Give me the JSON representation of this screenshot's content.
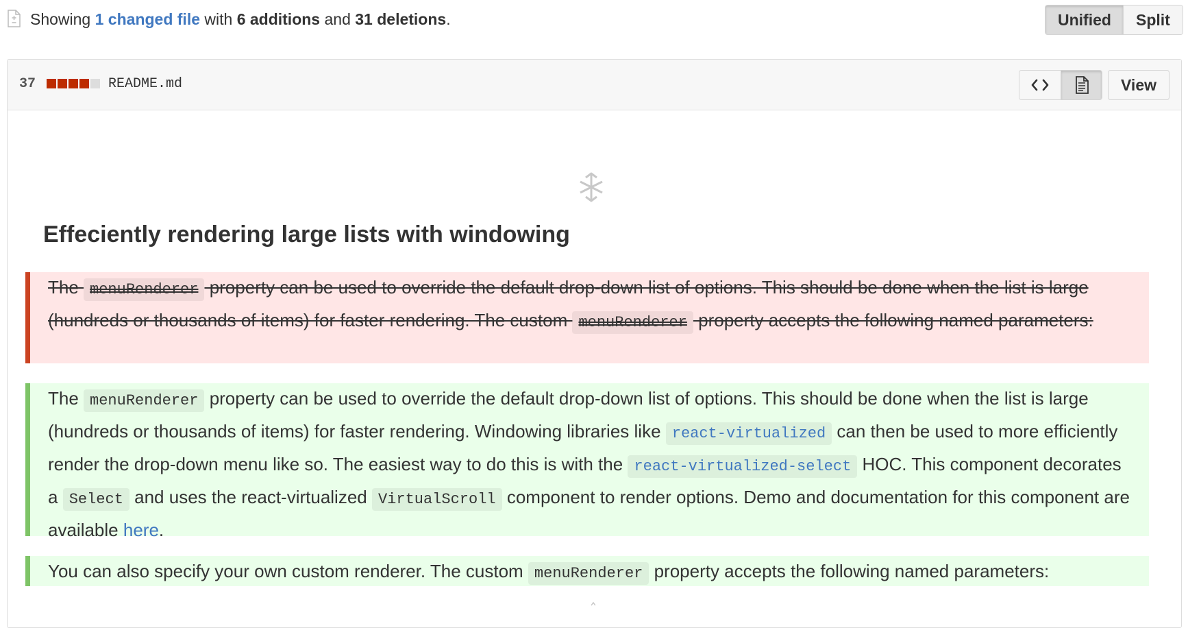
{
  "summary": {
    "prefix": "Showing",
    "changed_files": "1 changed file",
    "with": "with",
    "additions": "6 additions",
    "and": "and",
    "deletions": "31 deletions",
    "period": "."
  },
  "view_mode": {
    "unified_label": "Unified",
    "split_label": "Split",
    "active": "Unified"
  },
  "file": {
    "change_count": "37",
    "diffstat": [
      "deleted",
      "deleted",
      "deleted",
      "deleted",
      "neutral"
    ],
    "name": "README.md",
    "view_label": "View",
    "source_icon": "code-icon",
    "rich_icon": "file-text-icon"
  },
  "diff": {
    "heading": "Effeciently rendering large lists with windowing",
    "removed": {
      "t1": "The ",
      "c1": "menuRenderer",
      "t2": " property can be used to override the default drop-down list of options. This should be done when the list is large (hundreds or thousands of items) for faster rendering. The custom ",
      "c2": "menuRenderer",
      "t3": " property accepts the following named parameters:"
    },
    "added1": {
      "t1": "The ",
      "c1": "menuRenderer",
      "t2": " property can be used to override the default drop-down list of options. This should be done when the list is large (hundreds or thousands of items) for faster rendering. Windowing libraries like ",
      "c2": "react-virtualized",
      "t3": " can then be used to more efficiently render the drop-down menu like so. The easiest way to do this is with the ",
      "c3": "react-virtualized-select",
      "t4": " HOC. This component decorates a ",
      "c4": "Select",
      "t5": " and uses the react-virtualized ",
      "c5": "VirtualScroll",
      "t6": " component to render options. Demo and documentation for this component are available ",
      "link": "here",
      "t7": "."
    },
    "added2": {
      "t1": "You can also specify your own custom renderer. The custom ",
      "c1": "menuRenderer",
      "t2": " property accepts the following named parameters:"
    }
  },
  "colors": {
    "link": "#4078c0",
    "deleted_bg": "#ffe6e6",
    "deleted_bar": "#cb4322",
    "added_bg": "#eaffea",
    "added_bar": "#7ec467",
    "diffstat_deleted": "#bd2c00"
  }
}
